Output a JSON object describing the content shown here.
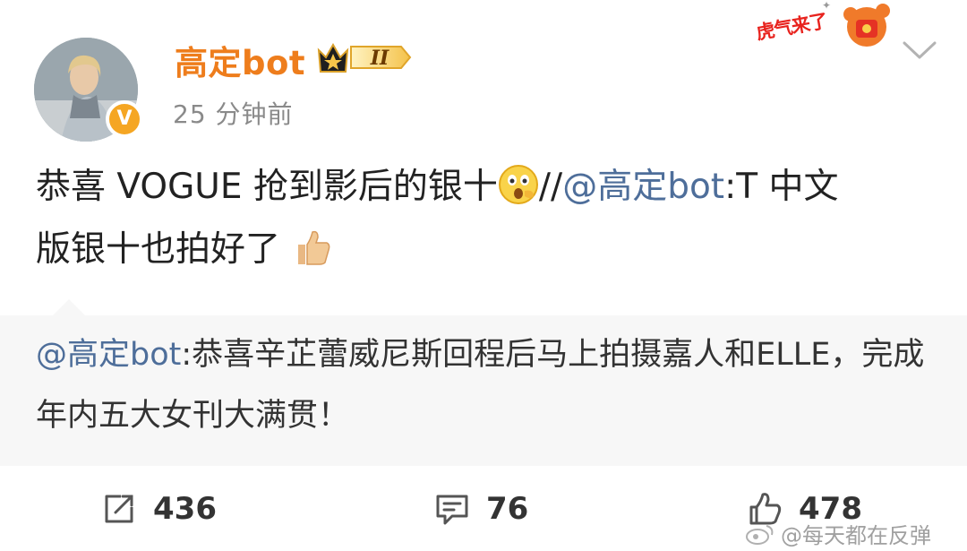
{
  "header": {
    "username": "高定bot",
    "vip_level": "II",
    "timestamp": "25 分钟前",
    "festival_badge": "虎气来了",
    "verified_mark": "V"
  },
  "post": {
    "text_start": "恭喜 VOGUE 抢到影后的银十",
    "separator": "//",
    "mention": "@高定bot",
    "text_after": ":T 中文",
    "text_line2": "版银十也拍好了"
  },
  "repost": {
    "mention": "@高定bot",
    "text": ":恭喜辛芷蕾威尼斯回程后马上拍摄嘉人和ELLE，完成年内五大女刊大满贯！"
  },
  "actions": {
    "repost_count": "436",
    "comment_count": "76",
    "like_count": "478"
  },
  "watermark": "@每天都在反弹",
  "colors": {
    "username": "#ee7d1c",
    "mention": "#4e6e9a",
    "repost_bg": "#f7f7f7",
    "timestamp": "#8a8a8a"
  },
  "icons": {
    "repost": "share-box-icon",
    "comment": "comment-bubble-icon",
    "like": "thumbs-up-icon",
    "more": "chevron-down-icon"
  }
}
